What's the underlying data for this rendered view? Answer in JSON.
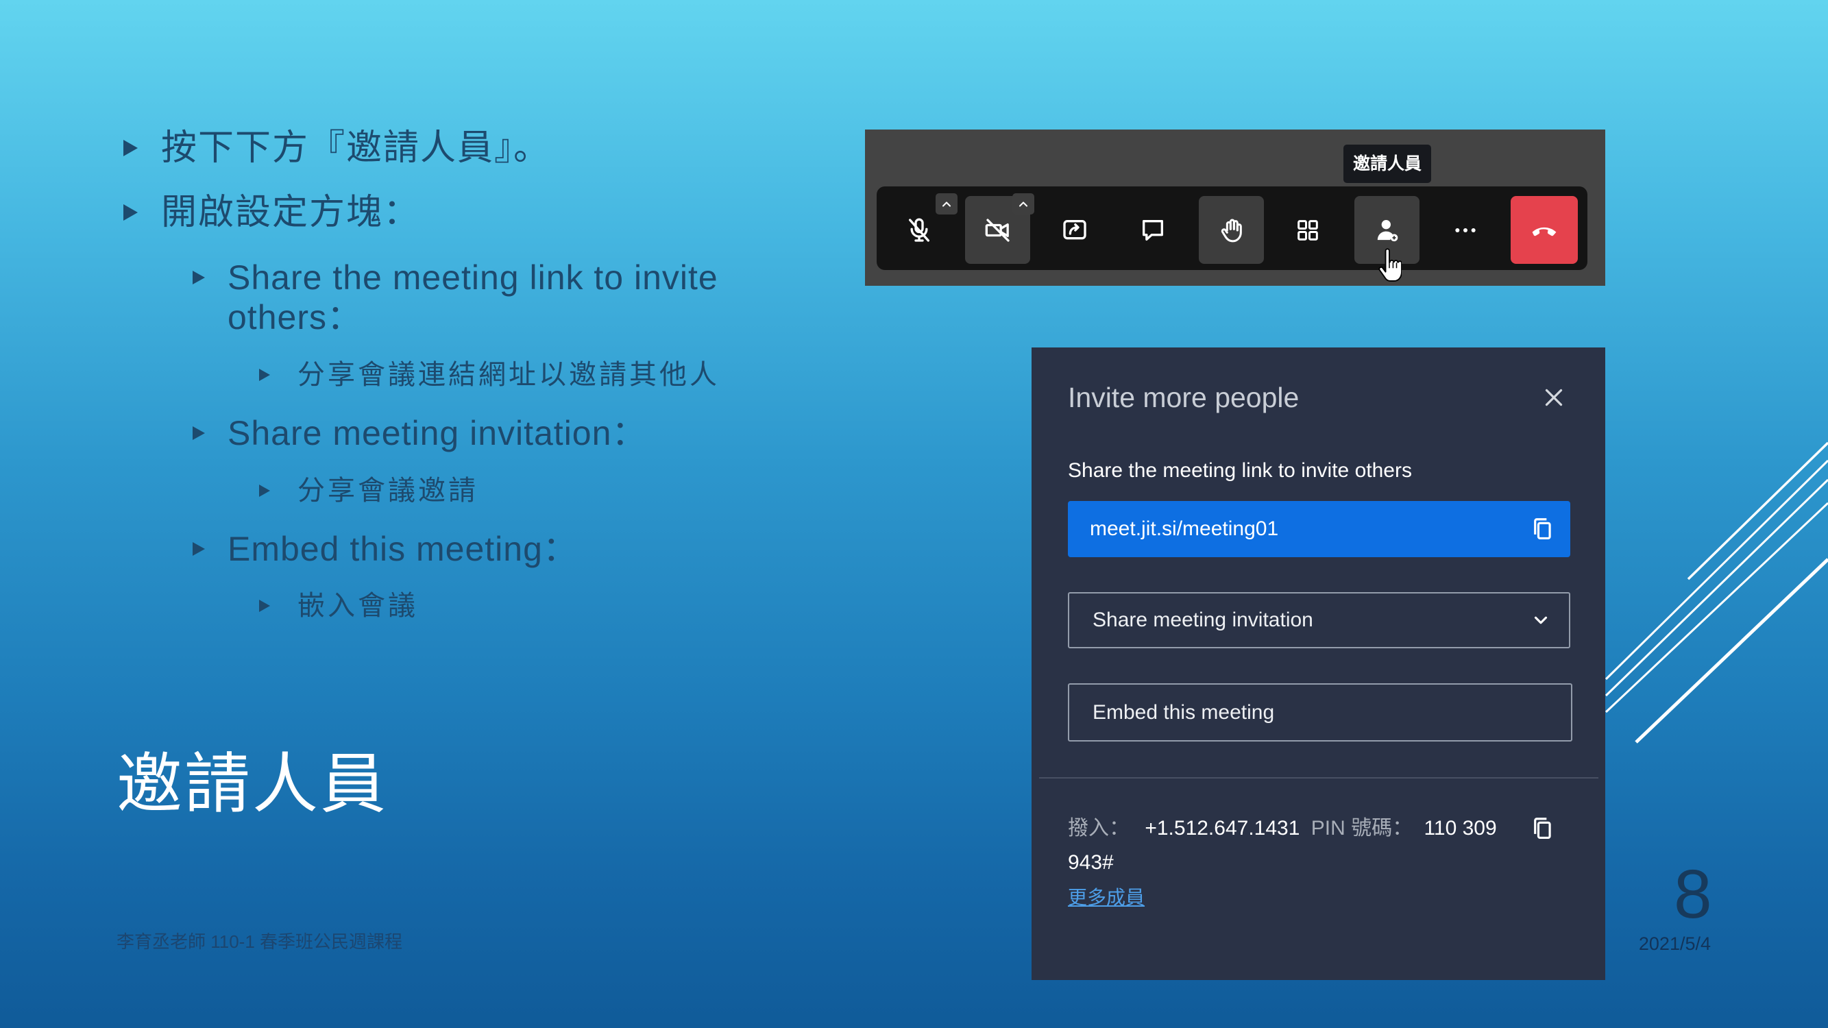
{
  "slide": {
    "bullets": [
      {
        "level": 1,
        "text": "按下下方『邀請人員』。"
      },
      {
        "level": 1,
        "text": "開啟設定方塊："
      },
      {
        "level": 2,
        "text": "Share the meeting link to invite others："
      },
      {
        "level": 3,
        "text": "分享會議連結網址以邀請其他人"
      },
      {
        "level": 2,
        "text": "Share meeting invitation："
      },
      {
        "level": 3,
        "text": "分享會議邀請"
      },
      {
        "level": 2,
        "text": "Embed this meeting："
      },
      {
        "level": 3,
        "text": "嵌入會議"
      }
    ],
    "title": "邀請人員",
    "footer": "李育丞老師 110-1 春季班公民週課程",
    "page_number": "8",
    "date": "2021/5/4"
  },
  "toolbar": {
    "tooltip": "邀請人員",
    "buttons": [
      {
        "icon": "mic-off-icon",
        "highlighted": false,
        "has_options_caret": true
      },
      {
        "icon": "camera-off-icon",
        "highlighted": true,
        "has_options_caret": true
      },
      {
        "icon": "share-screen-icon",
        "highlighted": false
      },
      {
        "icon": "chat-icon",
        "highlighted": false
      },
      {
        "icon": "raise-hand-icon",
        "highlighted": true
      },
      {
        "icon": "tile-view-icon",
        "highlighted": false
      },
      {
        "icon": "invite-people-icon",
        "highlighted": true,
        "hovered": true
      },
      {
        "icon": "more-icon",
        "highlighted": false
      },
      {
        "icon": "hangup-icon",
        "highlighted": true
      }
    ]
  },
  "invite_dialog": {
    "title": "Invite more people",
    "share_link_label": "Share the meeting link to invite others",
    "meeting_link": "meet.jit.si/meeting01",
    "share_invitation_label": "Share meeting invitation",
    "embed_label": "Embed this meeting",
    "dial_in": {
      "label": "撥入：",
      "number": "+1.512.647.1431",
      "pin_label": "PIN 號碼：",
      "pin": "110 309 943#"
    },
    "more_numbers_link": "更多成員"
  },
  "colors": {
    "background_top": "#62d4ef",
    "background_bottom": "#105b99",
    "bullet_text": "#1d4a6e",
    "panel_bg": "#2a3246",
    "link_box_blue": "#0e6fe2",
    "hangup_red": "#e5424d",
    "tooltip_bg": "#17191e",
    "link_text_blue": "#4d9ee8"
  }
}
